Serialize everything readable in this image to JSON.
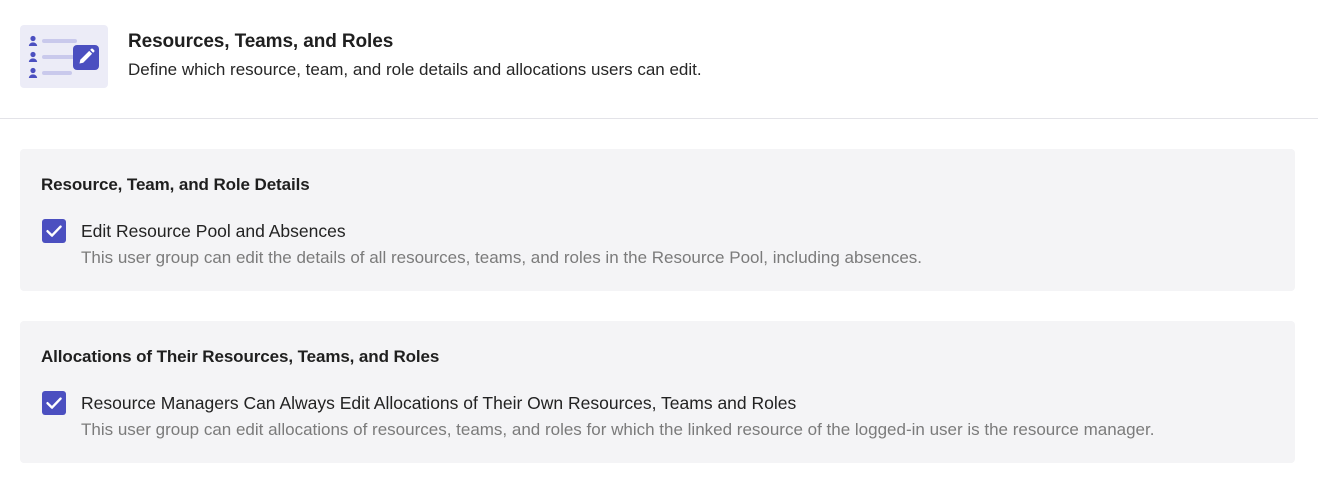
{
  "header": {
    "icon": "user-list-edit-icon",
    "title": "Resources, Teams, and Roles",
    "subtitle": "Define which resource, team, and role details and allocations users can edit."
  },
  "sections": [
    {
      "title": "Resource, Team, and Role Details",
      "option": {
        "checked": true,
        "label": "Edit Resource Pool and Absences",
        "description": "This user group can edit the details of all resources, teams, and roles in the Resource Pool, including absences."
      }
    },
    {
      "title": "Allocations of Their Resources, Teams, and Roles",
      "option": {
        "checked": true,
        "label": "Resource Managers Can Always Edit Allocations of Their Own Resources, Teams and Roles",
        "description": "This user group can edit allocations of resources, teams, and roles for which the linked resource of the logged-in user is the resource manager."
      }
    }
  ],
  "colors": {
    "accent": "#4b4fc0",
    "section_bg": "#f4f4f6",
    "icon_bg": "#ececf7",
    "muted_text": "#7b7b7b"
  }
}
